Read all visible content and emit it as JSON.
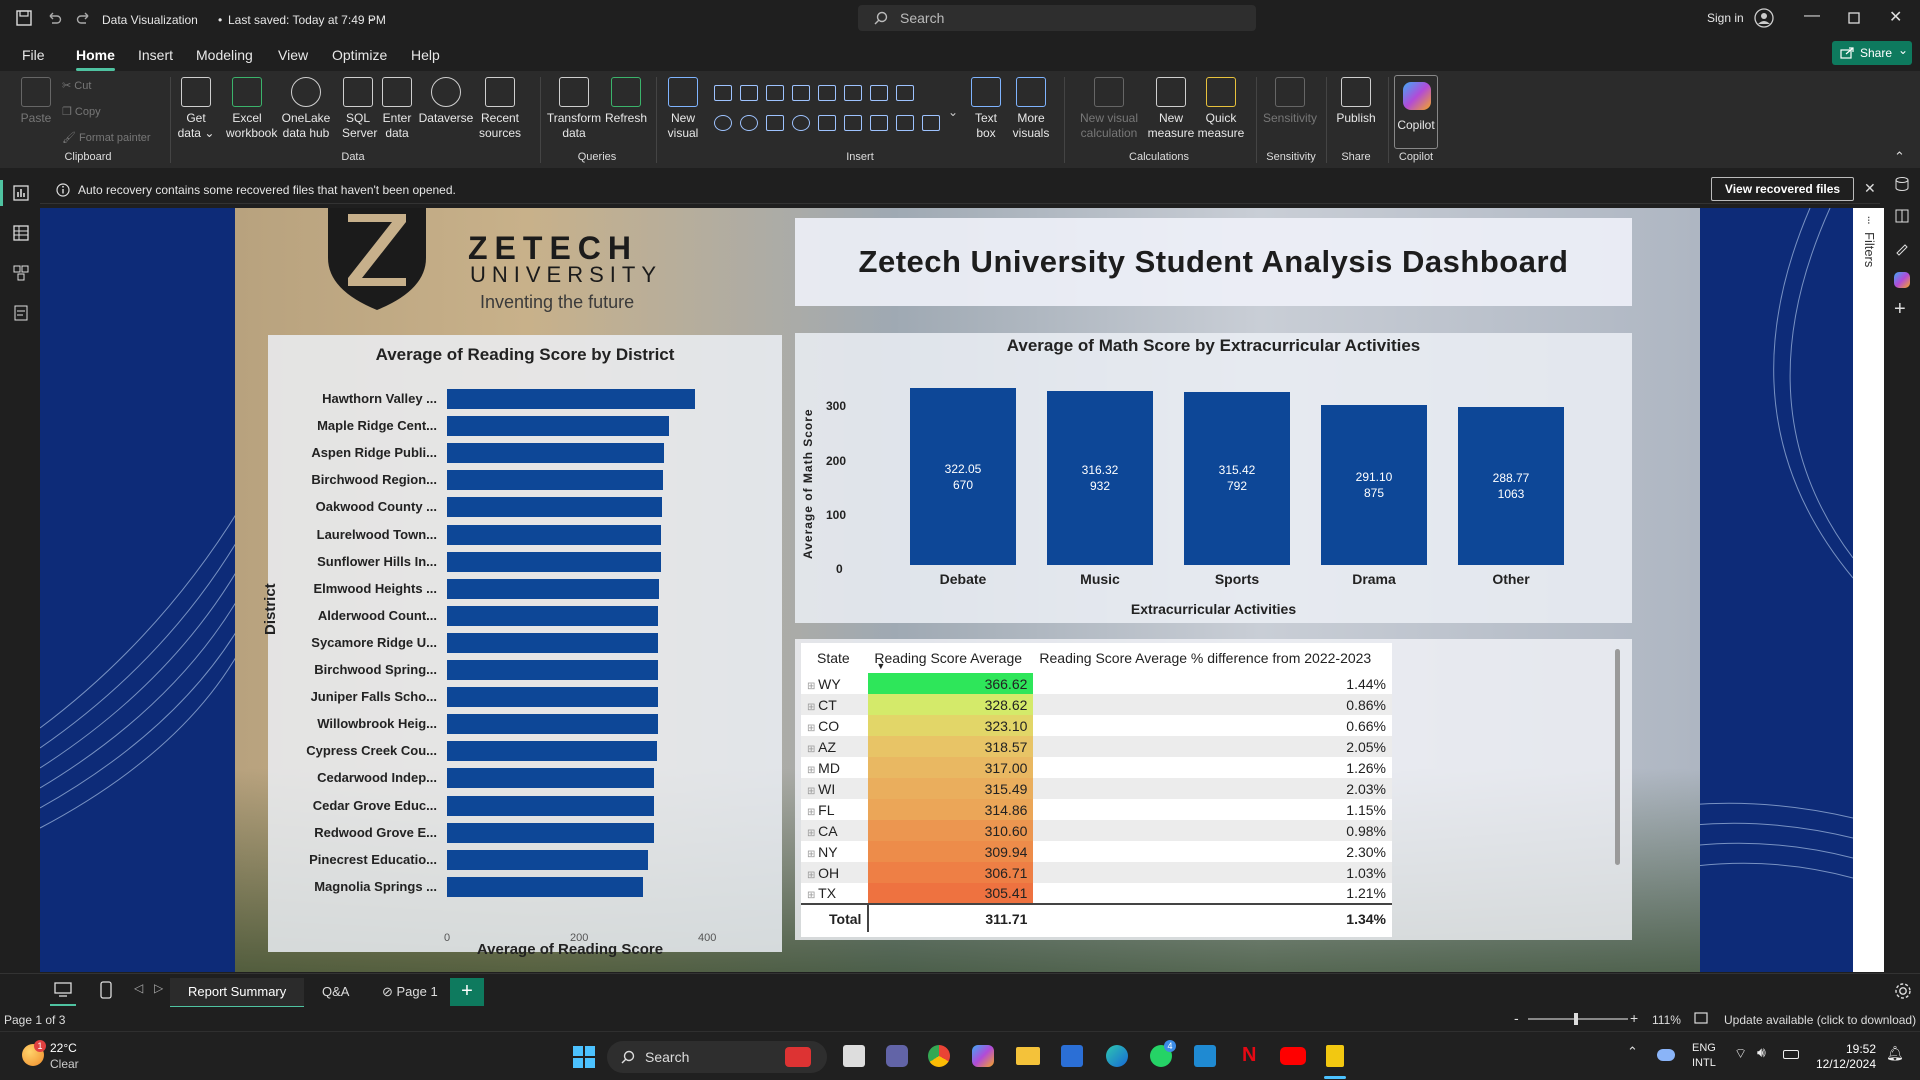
{
  "app": {
    "doc_title": "Data Visualization",
    "saved_status": "Last saved: Today at 7:49 PM",
    "search_placeholder": "Search",
    "sign_in": "Sign in",
    "share": "Share"
  },
  "menu": [
    "File",
    "Home",
    "Insert",
    "Modeling",
    "View",
    "Optimize",
    "Help"
  ],
  "ribbon": {
    "clipboard": {
      "paste": "Paste",
      "cut": "Cut",
      "copy": "Copy",
      "format_painter": "Format painter",
      "label": "Clipboard"
    },
    "data": {
      "items": [
        "Get data",
        "Excel workbook",
        "OneLake data hub",
        "SQL Server",
        "Enter data",
        "Dataverse",
        "Recent sources"
      ],
      "label": "Data"
    },
    "queries": {
      "items": [
        "Transform data",
        "Refresh"
      ],
      "label": "Queries"
    },
    "insert": {
      "new_visual": "New visual",
      "text_box": "Text box",
      "more_visuals": "More visuals",
      "label": "Insert"
    },
    "calculations": {
      "items": [
        "New visual calculation",
        "New measure",
        "Quick measure"
      ],
      "label": "Calculations"
    },
    "sensitivity": {
      "item": "Sensitivity",
      "label": "Sensitivity"
    },
    "share": {
      "item": "Publish",
      "label": "Share"
    },
    "copilot": {
      "item": "Copilot",
      "label": "Copilot"
    }
  },
  "notification": {
    "text": "Auto recovery contains some recovered files that haven't been opened.",
    "button": "View recovered files"
  },
  "report": {
    "logo": {
      "name_line1": "ZETECH",
      "name_line2": "UNIVERSITY",
      "tagline": "Inventing the future"
    },
    "title": "Zetech University Student Analysis Dashboard",
    "filters_label": "Filters"
  },
  "chart_data": [
    {
      "type": "bar",
      "title": "Average of Reading Score by District",
      "xlabel": "Average of Reading Score",
      "ylabel": "District",
      "xlim": [
        0,
        400
      ],
      "xticks": [
        "0",
        "200",
        "400"
      ],
      "categories": [
        "Hawthorn Valley ...",
        "Maple Ridge Cent...",
        "Aspen Ridge Publi...",
        "Birchwood Region...",
        "Oakwood County ...",
        "Laurelwood Town...",
        "Sunflower Hills In...",
        "Elmwood Heights ...",
        "Alderwood Count...",
        "Sycamore Ridge U...",
        "Birchwood Spring...",
        "Juniper Falls Scho...",
        "Willowbrook Heig...",
        "Cypress Creek Cou...",
        "Cedarwood Indep...",
        "Cedar Grove Educ...",
        "Redwood Grove E...",
        "Pinecrest Educatio...",
        "Magnolia Springs ..."
      ],
      "values": [
        381,
        342,
        334,
        333,
        330,
        329,
        329,
        326,
        325,
        325,
        325,
        324,
        324,
        323,
        319,
        318,
        318,
        309,
        302
      ]
    },
    {
      "type": "bar",
      "title": "Average of Math Score by Extracurricular Activities",
      "xlabel": "Extracurricular Activities",
      "ylabel": "Average of Math Score",
      "ylim": [
        0,
        330
      ],
      "yticks": [
        "0",
        "100",
        "200",
        "300"
      ],
      "categories": [
        "Debate",
        "Music",
        "Sports",
        "Drama",
        "Other"
      ],
      "values": [
        322.05,
        316.32,
        315.42,
        291.1,
        288.77
      ],
      "value_labels": [
        "322.05",
        "316.32",
        "315.42",
        "291.10",
        "288.77"
      ],
      "count_labels": [
        "670",
        "932",
        "792",
        "875",
        "1063"
      ]
    },
    {
      "type": "table",
      "columns": [
        "State",
        "Reading Score Average",
        "Reading Score Average % difference from 2022-2023"
      ],
      "rows": [
        [
          "WY",
          "366.62",
          "1.44%"
        ],
        [
          "CT",
          "328.62",
          "0.86%"
        ],
        [
          "CO",
          "323.10",
          "0.66%"
        ],
        [
          "AZ",
          "318.57",
          "2.05%"
        ],
        [
          "MD",
          "317.00",
          "1.26%"
        ],
        [
          "WI",
          "315.49",
          "2.03%"
        ],
        [
          "FL",
          "314.86",
          "1.15%"
        ],
        [
          "CA",
          "310.60",
          "0.98%"
        ],
        [
          "NY",
          "309.94",
          "2.30%"
        ],
        [
          "OH",
          "306.71",
          "1.03%"
        ],
        [
          "TX",
          "305.41",
          "1.21%"
        ]
      ],
      "row_colors": [
        "#2ee65a",
        "#d4ea6a",
        "#e2d668",
        "#e8c466",
        "#e9b862",
        "#eaae5d",
        "#eba658",
        "#ec9650",
        "#ed8c4a",
        "#ee7f45",
        "#ee7240"
      ],
      "total": [
        "Total",
        "311.71",
        "1.34%"
      ]
    }
  ],
  "pages": {
    "tabs": [
      "Report Summary",
      "Q&A",
      "Page 1"
    ],
    "active": "Report Summary",
    "page_indicator": "Page 1 of 3"
  },
  "status": {
    "zoom": "111%",
    "update": "Update available (click to download)"
  },
  "taskbar": {
    "weather_temp": "22°C",
    "weather_desc": "Clear",
    "weather_badge": "1",
    "search": "Search",
    "lang1": "ENG",
    "lang2": "INTL",
    "time": "19:52",
    "date": "12/12/2024",
    "whatsapp_badge": "4"
  }
}
